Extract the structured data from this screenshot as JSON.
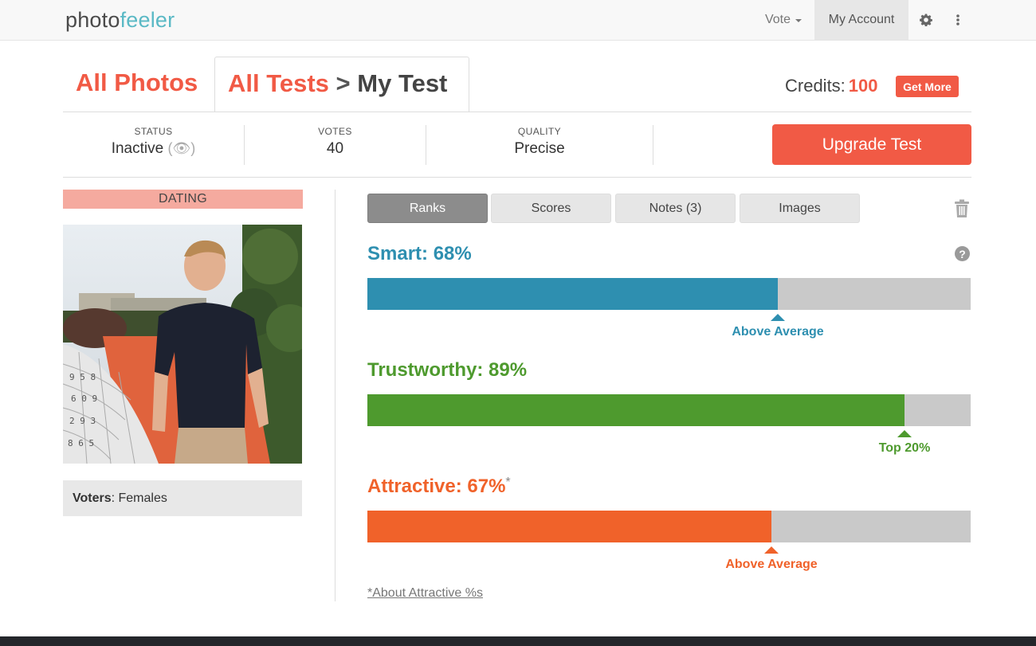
{
  "logo": {
    "part1": "photo",
    "part2": "feeler"
  },
  "nav": {
    "vote": "Vote",
    "account": "My Account",
    "settings_icon": "gear-icon",
    "more_icon": "vertical-dots-icon"
  },
  "tabs": {
    "all_photos": "All Photos",
    "all_tests": "All Tests",
    "separator": ">",
    "current": "My Test"
  },
  "credits": {
    "label": "Credits:",
    "value": "100",
    "get_more": "Get More"
  },
  "stats": {
    "status": {
      "label": "STATUS",
      "value": "Inactive",
      "icon": "(👁)"
    },
    "votes": {
      "label": "VOTES",
      "value": "40"
    },
    "quality": {
      "label": "QUALITY",
      "value": "Precise"
    }
  },
  "upgrade_label": "Upgrade Test",
  "category": "DATING",
  "voters": {
    "label": "Voters",
    "value": ": Females"
  },
  "result_tabs": [
    "Ranks",
    "Scores",
    "Notes (3)",
    "Images"
  ],
  "metrics": [
    {
      "title": "Smart: 68%",
      "suffix": "",
      "percent": 68,
      "marker_label": "Above Average",
      "color": "#2e8fb0"
    },
    {
      "title": "Trustworthy: 89%",
      "suffix": "",
      "percent": 89,
      "marker_label": "Top 20%",
      "color": "#4e9a2e"
    },
    {
      "title": "Attractive: 67%",
      "suffix": "*",
      "percent": 67,
      "marker_label": "Above Average",
      "color": "#f0622a"
    }
  ],
  "about_link": "*About Attractive %s",
  "colors": {
    "accent": "#f15a45",
    "track": "#c9c9c9"
  }
}
